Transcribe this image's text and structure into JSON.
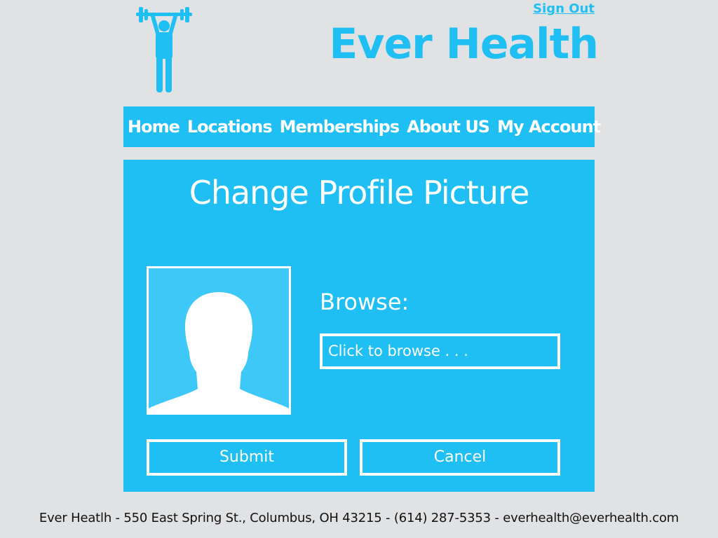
{
  "header": {
    "logo_icon": "weightlifter-icon",
    "signout_label": "Sign Out",
    "brand": "Ever Health",
    "accent_color": "#1fbff4"
  },
  "nav": {
    "items": [
      {
        "label": "Home"
      },
      {
        "label": "Locations"
      },
      {
        "label": "Memberships"
      },
      {
        "label": "About US"
      },
      {
        "label": "My Account"
      }
    ]
  },
  "main": {
    "title": "Change Profile Picture",
    "avatar_icon": "user-silhouette-icon",
    "browse_label": "Browse:",
    "browse_field_placeholder": "Click to browse . . .",
    "submit_label": "Submit",
    "cancel_label": "Cancel"
  },
  "footer": {
    "text": "Ever Heatlh - 550 East Spring St., Columbus, OH 43215 - (614) 287-5353 - everhealth@everhealth.com"
  }
}
